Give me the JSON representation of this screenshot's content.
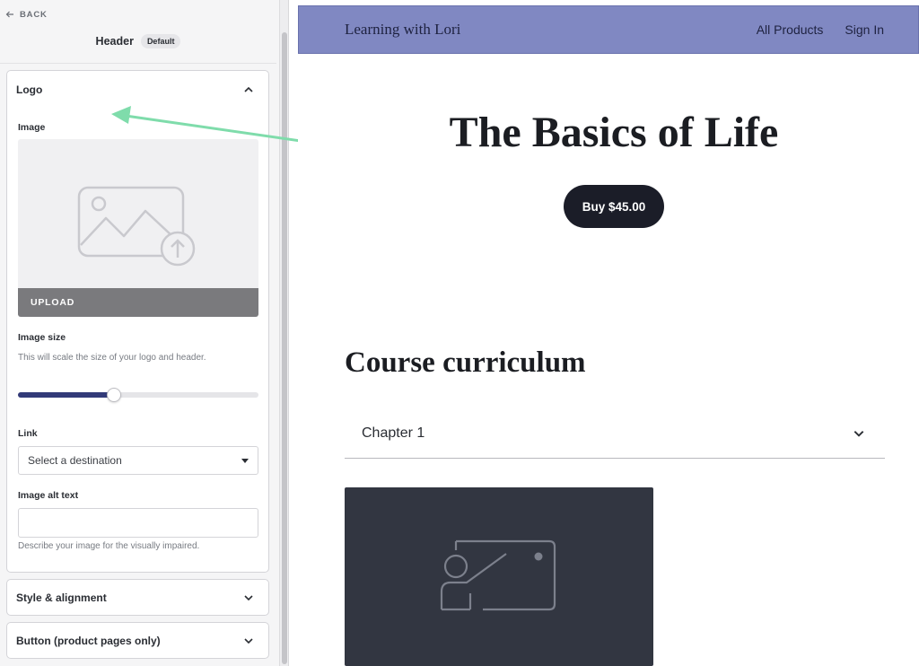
{
  "sidebar": {
    "back_label": "BACK",
    "header_title": "Header",
    "header_badge": "Default",
    "logo_section": {
      "title": "Logo",
      "image_label": "Image",
      "upload_label": "UPLOAD",
      "image_size_label": "Image size",
      "image_size_help": "This will scale the size of your logo and header.",
      "image_size_value_fraction": 0.4,
      "link_label": "Link",
      "link_select_value": "Select a destination",
      "alt_text_label": "Image alt text",
      "alt_text_value": "",
      "alt_text_help": "Describe your image for the visually impaired."
    },
    "style_section": {
      "title": "Style & alignment"
    },
    "button_section": {
      "title": "Button (product pages only)"
    }
  },
  "preview": {
    "brand": "Learning with Lori",
    "nav": [
      "All Products",
      "Sign In"
    ],
    "hero_title": "The Basics of Life",
    "buy_button": "Buy $45.00",
    "curriculum_title": "Course curriculum",
    "chapter_label": "Chapter 1"
  },
  "colors": {
    "header_bg": "#8088c2",
    "slider_fill": "#323a78",
    "arrow": "#7fdcab",
    "buy_button_bg": "#1b1d28",
    "thumbnail_bg": "#323641"
  },
  "icons": {
    "back": "arrow-left-icon",
    "collapse": "chevron-up-icon",
    "expand": "chevron-down-icon",
    "upload_placeholder": "image-upload-icon",
    "lesson_placeholder": "presentation-icon"
  }
}
